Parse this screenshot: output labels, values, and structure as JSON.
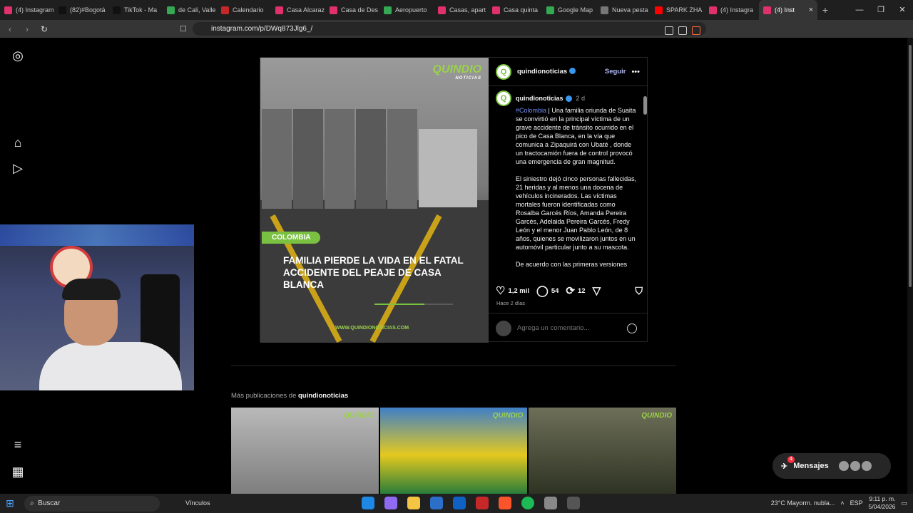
{
  "browser": {
    "tabs": [
      {
        "label": "(4) Instagram",
        "color": "#e1306c"
      },
      {
        "label": "(82)#Bogotá",
        "color": "#111111"
      },
      {
        "label": "TikTok - Ma",
        "color": "#111111"
      },
      {
        "label": "de Cali, Valle",
        "color": "#34a853"
      },
      {
        "label": "Calendario",
        "color": "#c62828"
      },
      {
        "label": "Casa Alcaraz",
        "color": "#e1306c"
      },
      {
        "label": "Casa de Des",
        "color": "#e1306c"
      },
      {
        "label": "Aeropuerto",
        "color": "#34a853"
      },
      {
        "label": "Casas, apart",
        "color": "#e1306c"
      },
      {
        "label": "Casa quinta",
        "color": "#e1306c"
      },
      {
        "label": "Google Map",
        "color": "#34a853"
      },
      {
        "label": "Nueva pesta",
        "color": "#777777"
      },
      {
        "label": "SPARK ZHA",
        "color": "#ff0000"
      },
      {
        "label": "(4) Instagra",
        "color": "#e1306c"
      }
    ],
    "active_tab": "(4) Inst",
    "url": "instagram.com/p/DWq873Jlg6_/"
  },
  "post": {
    "username": "quindionoticias",
    "follow_label": "Seguir",
    "image": {
      "brand": "QUINDIO",
      "brand_sub": "NOTICIAS",
      "tag": "COLOMBIA",
      "headline": "FAMILIA PIERDE LA VIDA EN EL FATAL ACCIDENTE DEL PEAJE DE CASA BLANCA",
      "site": "WWW.QUINDIONOTICIAS.COM"
    },
    "caption_time": "2 d",
    "hashtag": "#Colombia",
    "caption_p1": " | Una familia oriunda de Suaita se convirtió en la principal víctima de un grave accidente de tránsito ocurrido en el pico de Casa Blanca, en la vía que comunica a Zipaquirá con Ubaté , donde un tractocamión fuera de control provocó una emergencia de gran magnitud.",
    "caption_p2": "El siniestro dejó cinco personas fallecidas, 21 heridas y al menos una docena de vehículos incinerados. Las víctimas mortales fueron identificadas como Rosalba Garcés Ríos, Amanda Pereira Garcés, Adelaida Pereira Garcés, Fredy León y el menor Juan Pablo León, de 8 años, quienes se movilizaron juntos en un automóvil particular junto a su mascota.",
    "caption_p3": "De acuerdo con las primeras versiones",
    "likes": "1,2 mil",
    "comments": "54",
    "reposts": "12",
    "ago": "Hace 2 días",
    "comment_placeholder": "Agrega un comentario..."
  },
  "more": {
    "prefix": "Más publicaciones de ",
    "username": "quindionoticias"
  },
  "messages": {
    "label": "Mensajes",
    "badge": "4"
  },
  "taskbar": {
    "search": "Buscar",
    "links": "Vínculos",
    "weather": "23°C  Mayorm. nubla...",
    "lang": "ESP",
    "time": "9:11 p. m.",
    "date": "5/04/2026"
  }
}
